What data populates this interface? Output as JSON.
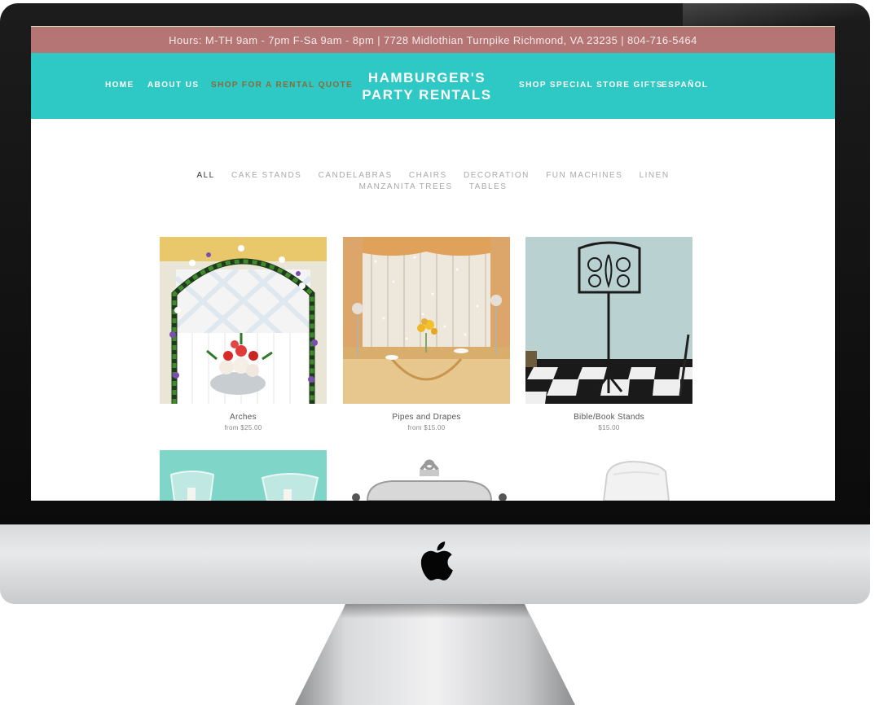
{
  "topbar": {
    "text": "Hours: M-TH 9am - 7pm  F-Sa 9am - 8pm | 7728 Midlothian Turnpike Richmond, VA 23235 | 804-716-5464"
  },
  "nav": {
    "home": "HOME",
    "about": "ABOUT US",
    "shop_rental": "SHOP FOR A RENTAL QUOTE",
    "brand_line1": "HAMBURGER'S",
    "brand_line2": "PARTY RENTALS",
    "shop_gifts": "SHOP SPECIAL STORE GIFTS",
    "espanol": "ESPAÑOL"
  },
  "filters": {
    "row1": [
      "ALL",
      "CAKE STANDS",
      "CANDELABRAS",
      "CHAIRS",
      "DECORATION",
      "FUN MACHINES",
      "LINEN"
    ],
    "row2": [
      "MANZANITA TREES",
      "TABLES"
    ]
  },
  "products": [
    {
      "title": "Arches",
      "price": "from $25.00"
    },
    {
      "title": "Pipes and Drapes",
      "price": "from $15.00"
    },
    {
      "title": "Bible/Book Stands",
      "price": "$15.00"
    }
  ],
  "colors": {
    "topbar": "#b57575",
    "navbar": "#2ec9c4",
    "active_nav": "#8a6a3c"
  },
  "icons": {
    "device_logo": "apple-icon"
  }
}
